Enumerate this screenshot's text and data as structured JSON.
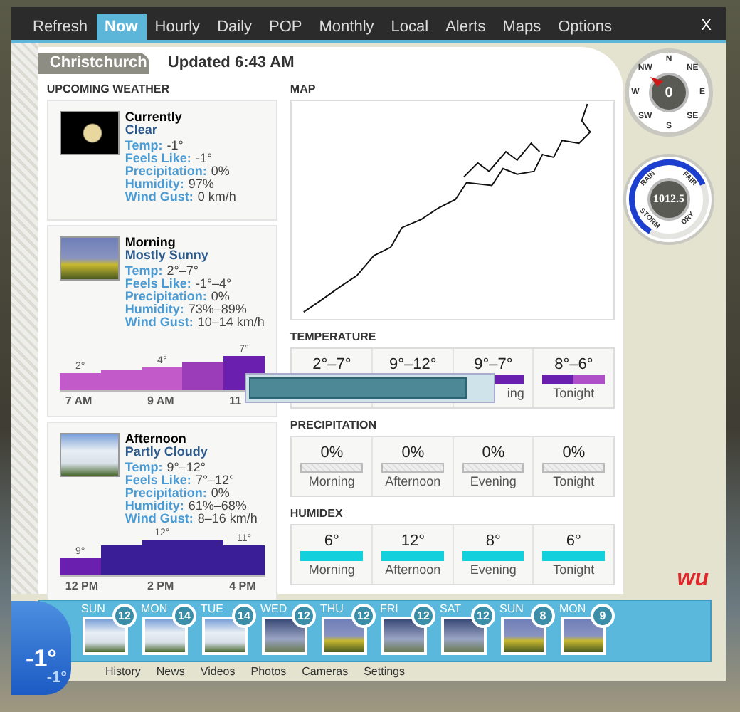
{
  "tabs": [
    {
      "label": "Refresh",
      "selected": false
    },
    {
      "label": "Now",
      "selected": true
    },
    {
      "label": "Hourly",
      "selected": false
    },
    {
      "label": "Daily",
      "selected": false
    },
    {
      "label": "POP",
      "selected": false
    },
    {
      "label": "Monthly",
      "selected": false
    },
    {
      "label": "Local",
      "selected": false
    },
    {
      "label": "Alerts",
      "selected": false
    },
    {
      "label": "Maps",
      "selected": false
    },
    {
      "label": "Options",
      "selected": false
    }
  ],
  "close": "X",
  "location": "Christchurch",
  "updated": "Updated 6:43 AM",
  "upcoming": {
    "title": "UPCOMING WEATHER",
    "cards": [
      {
        "kind": "night",
        "period": "Currently",
        "condition": "Clear",
        "details": [
          {
            "label": "Temp:",
            "value": "-1°"
          },
          {
            "label": "Feels Like:",
            "value": "-1°"
          },
          {
            "label": "Precipitation:",
            "value": "0%"
          },
          {
            "label": "Humidity:",
            "value": "97%"
          },
          {
            "label": "Wind Gust:",
            "value": "0 km/h"
          }
        ]
      },
      {
        "kind": "sunny",
        "period": "Morning",
        "condition": "Mostly Sunny",
        "details": [
          {
            "label": "Temp:",
            "value": "2°–7°"
          },
          {
            "label": "Feels Like:",
            "value": "-1°–4°"
          },
          {
            "label": "Precipitation:",
            "value": "0%"
          },
          {
            "label": "Humidity:",
            "value": "73%–89%"
          },
          {
            "label": "Wind Gust:",
            "value": "10–14 km/h"
          }
        ],
        "bars": [
          {
            "color": "#c25bc9",
            "label": "2°",
            "tick": "7 AM"
          },
          {
            "color": "#c25bc9"
          },
          {
            "color": "#c25bc9",
            "label": "4°",
            "tick": "9 AM"
          },
          {
            "color": "#9b3db8"
          },
          {
            "color": "#6a1fae",
            "label": "7°",
            "tick": "11"
          }
        ]
      },
      {
        "kind": "cloudy",
        "period": "Afternoon",
        "condition": "Partly Cloudy",
        "details": [
          {
            "label": "Temp:",
            "value": "9°–12°"
          },
          {
            "label": "Feels Like:",
            "value": "7°–12°"
          },
          {
            "label": "Precipitation:",
            "value": "0%"
          },
          {
            "label": "Humidity:",
            "value": "61%–68%"
          },
          {
            "label": "Wind Gust:",
            "value": "8–16 km/h"
          }
        ],
        "bars": [
          {
            "color": "#6a1fae",
            "label": "9°",
            "tick": "12 PM"
          },
          {
            "color": "#3a1e98"
          },
          {
            "color": "#3a1e98",
            "label": "12°",
            "tick": "2 PM"
          },
          {
            "color": "#3a1e98"
          },
          {
            "color": "#3a1e98",
            "label": "11°",
            "tick": "4 PM"
          }
        ]
      }
    ]
  },
  "map": {
    "title": "MAP"
  },
  "temperature": {
    "title": "TEMPERATURE",
    "cells": [
      {
        "value": "2°–7°"
      },
      {
        "value": "9°–12°"
      },
      {
        "value": "9°–7°",
        "label": "ing"
      },
      {
        "value": "8°–6°",
        "label": "Tonight"
      }
    ]
  },
  "precipitation": {
    "title": "PRECIPITATION",
    "cells": [
      {
        "value": "0%",
        "label": "Morning"
      },
      {
        "value": "0%",
        "label": "Afternoon"
      },
      {
        "value": "0%",
        "label": "Evening"
      },
      {
        "value": "0%",
        "label": "Tonight"
      }
    ]
  },
  "humidex": {
    "title": "HUMIDEX",
    "cells": [
      {
        "value": "6°",
        "label": "Morning"
      },
      {
        "value": "12°",
        "label": "Afternoon"
      },
      {
        "value": "8°",
        "label": "Evening"
      },
      {
        "value": "6°",
        "label": "Tonight"
      }
    ]
  },
  "progress": {
    "level": 0.9
  },
  "compass": {
    "value": "0",
    "directions": [
      "N",
      "NE",
      "E",
      "SE",
      "S",
      "SW",
      "W",
      "NW"
    ]
  },
  "pressure": {
    "value": "1012.5",
    "level": 0.6,
    "labels": [
      "RAIN",
      "FAIR",
      "STORM",
      "DRY"
    ]
  },
  "logo": "wu",
  "forecast": [
    {
      "day": "SUN",
      "value": "12",
      "kind": "cloudy"
    },
    {
      "day": "MON",
      "value": "14",
      "kind": "cloudy"
    },
    {
      "day": "TUE",
      "value": "14",
      "kind": "cloudy"
    },
    {
      "day": "WED",
      "value": "12",
      "kind": "overcast"
    },
    {
      "day": "THU",
      "value": "12",
      "kind": "sunny"
    },
    {
      "day": "FRI",
      "value": "12",
      "kind": "overcast"
    },
    {
      "day": "SAT",
      "value": "12",
      "kind": "overcast"
    },
    {
      "day": "SUN",
      "value": "8",
      "kind": "sunny"
    },
    {
      "day": "MON",
      "value": "9",
      "kind": "sunny"
    }
  ],
  "current": {
    "temp": "-1°",
    "feels": "-1°"
  },
  "nav": [
    "History",
    "News",
    "Videos",
    "Photos",
    "Cameras",
    "Settings"
  ]
}
